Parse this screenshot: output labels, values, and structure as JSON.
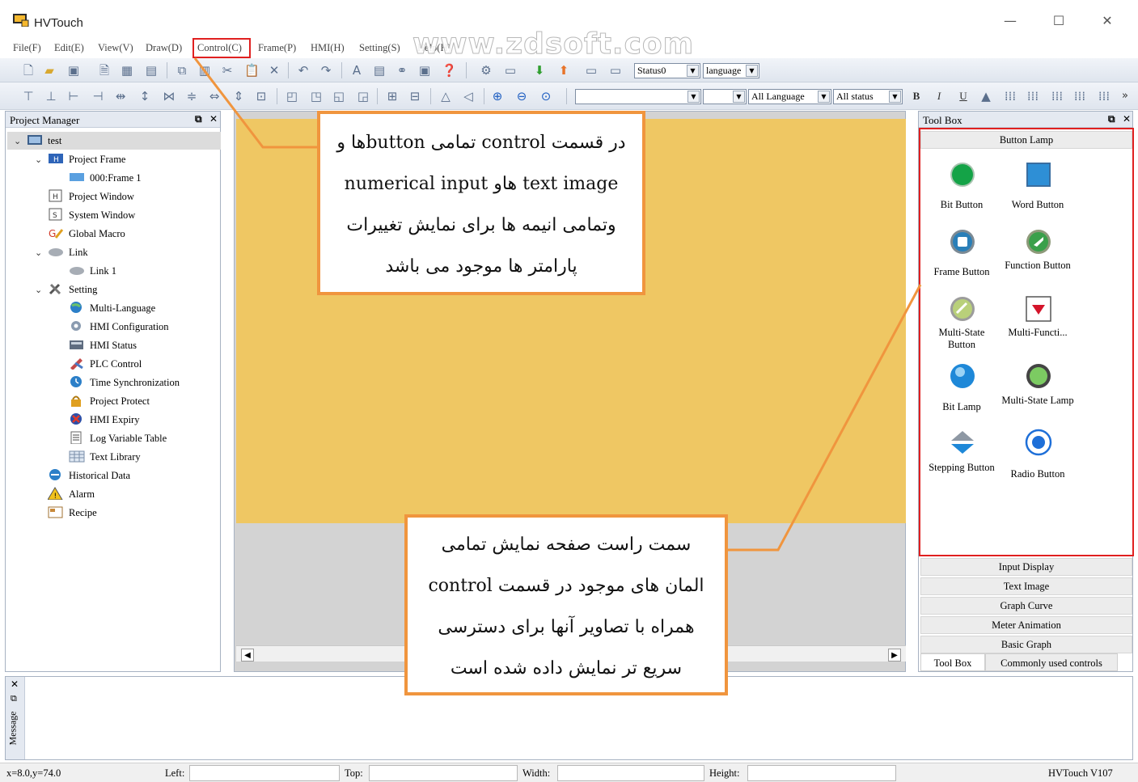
{
  "window": {
    "title": "HVTouch",
    "minimize": "—",
    "maximize": "☐",
    "close": "✕"
  },
  "menu": [
    "File(F)",
    "Edit(E)",
    "View(V)",
    "Draw(D)",
    "Control(C)",
    "Frame(P)",
    "HMI(H)",
    "Setting(S)",
    "Help(H)"
  ],
  "watermark": "www.zdsoft.com",
  "toolbar1": {
    "status_combo": "Status0",
    "language_combo": "language"
  },
  "toolbar2": {
    "all_language": "All Language",
    "all_status": "All status",
    "bold": "B",
    "italic": "I",
    "underline": "U",
    "overflow": "»"
  },
  "project_manager": {
    "title": "Project Manager",
    "tree": [
      {
        "label": "test",
        "level": 0,
        "toggle": "⌄",
        "icon": "project-icon"
      },
      {
        "label": "Project Frame",
        "level": 1,
        "toggle": "⌄",
        "icon": "frame-folder-icon"
      },
      {
        "label": "000:Frame 1",
        "level": 2,
        "toggle": "",
        "icon": "frame-icon"
      },
      {
        "label": "Project Window",
        "level": 1,
        "toggle": "",
        "icon": "window-icon"
      },
      {
        "label": "System Window",
        "level": 1,
        "toggle": "",
        "icon": "system-window-icon"
      },
      {
        "label": "Global Macro",
        "level": 1,
        "toggle": "",
        "icon": "macro-icon"
      },
      {
        "label": "Link",
        "level": 1,
        "toggle": "⌄",
        "icon": "link-icon"
      },
      {
        "label": "Link 1",
        "level": 2,
        "toggle": "",
        "icon": "link-item-icon"
      },
      {
        "label": "Setting",
        "level": 1,
        "toggle": "⌄",
        "icon": "tools-icon"
      },
      {
        "label": "Multi-Language",
        "level": 2,
        "toggle": "",
        "icon": "globe-icon"
      },
      {
        "label": "HMI Configuration",
        "level": 2,
        "toggle": "",
        "icon": "gear-icon"
      },
      {
        "label": "HMI Status",
        "level": 2,
        "toggle": "",
        "icon": "status-icon"
      },
      {
        "label": "PLC Control",
        "level": 2,
        "toggle": "",
        "icon": "plc-icon"
      },
      {
        "label": "Time Synchronization",
        "level": 2,
        "toggle": "",
        "icon": "clock-icon"
      },
      {
        "label": "Project Protect",
        "level": 2,
        "toggle": "",
        "icon": "lock-icon"
      },
      {
        "label": "HMI Expiry",
        "level": 2,
        "toggle": "",
        "icon": "expiry-icon"
      },
      {
        "label": "Log Variable Table",
        "level": 2,
        "toggle": "",
        "icon": "log-icon"
      },
      {
        "label": "Text Library",
        "level": 2,
        "toggle": "",
        "icon": "table-icon"
      },
      {
        "label": "Historical Data",
        "level": 1,
        "toggle": "",
        "icon": "history-icon"
      },
      {
        "label": "Alarm",
        "level": 1,
        "toggle": "",
        "icon": "alarm-icon"
      },
      {
        "label": "Recipe",
        "level": 1,
        "toggle": "",
        "icon": "recipe-icon"
      }
    ]
  },
  "toolbox": {
    "title": "Tool Box",
    "active_category": "Button Lamp",
    "items": [
      {
        "label": "Bit Button",
        "icon": "bit-button-icon"
      },
      {
        "label": "Word Button",
        "icon": "word-button-icon"
      },
      {
        "label": "Frame Button",
        "icon": "frame-button-icon"
      },
      {
        "label": "Function Button",
        "icon": "function-button-icon"
      },
      {
        "label": "Multi-State Button",
        "icon": "multi-state-button-icon"
      },
      {
        "label": "Multi-Functi...",
        "icon": "multi-function-icon"
      },
      {
        "label": "Bit Lamp",
        "icon": "bit-lamp-icon"
      },
      {
        "label": "Multi-State Lamp",
        "icon": "multi-state-lamp-icon"
      },
      {
        "label": "Stepping Button",
        "icon": "stepping-button-icon"
      },
      {
        "label": "Radio Button",
        "icon": "radio-button-icon"
      }
    ],
    "categories": [
      "Input Display",
      "Text Image",
      "Graph Curve",
      "Meter Animation",
      "Basic Graph"
    ],
    "tabs": [
      "Tool Box",
      "Commonly used controls"
    ]
  },
  "message_panel": {
    "label": "Message"
  },
  "statusbar": {
    "coords": "x=8.0,y=74.0",
    "left": "Left:",
    "top": "Top:",
    "width": "Width:",
    "height": "Height:",
    "version": "HVTouch V107"
  },
  "callouts": {
    "top": [
      "در قسمت control تمامی buttonها و",
      "text image هاو numerical input",
      "وتمامی انیمه ها برای نمایش تغییرات",
      "پارامتر ها موجود می باشد"
    ],
    "bottom": [
      "سمت راست صفحه نمایش تمامی",
      "المان های موجود در قسمت control",
      "همراه با تصاویر آنها برای دسترسی",
      "سریع تر نمایش داده شده است"
    ]
  },
  "colors": {
    "accent_highlight": "#e02020",
    "callout_border": "#f0953e",
    "frame_fill": "#efc763"
  }
}
